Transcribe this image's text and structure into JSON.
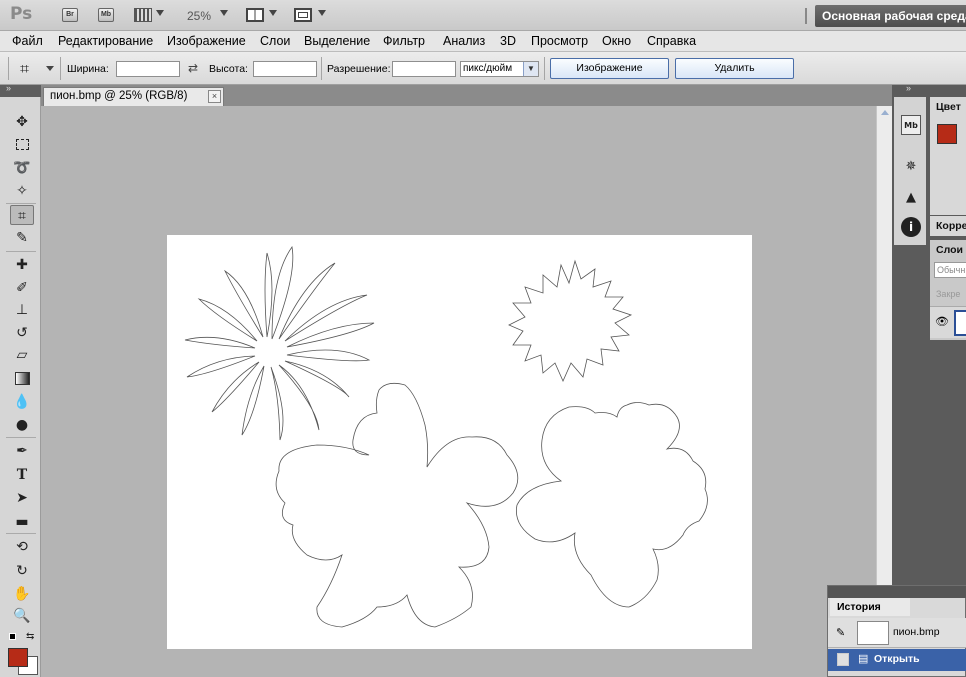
{
  "app": {
    "logo": "Ps",
    "appbar_buttons": [
      {
        "icon": "bridge-icon",
        "label": "Br"
      },
      {
        "icon": "minibridge-icon",
        "label": "Mb"
      }
    ],
    "zoom_display": "25%",
    "workspace": "Основная рабочая среда"
  },
  "menu": [
    "Файл",
    "Редактирование",
    "Изображение",
    "Слои",
    "Выделение",
    "Фильтр",
    "Анализ",
    "3D",
    "Просмотр",
    "Окно",
    "Справка"
  ],
  "options": {
    "width_label": "Ширина:",
    "height_label": "Высота:",
    "resolution_label": "Разрешение:",
    "units_value": "пикс/дюйм",
    "image_button": "Изображение",
    "delete_button": "Удалить"
  },
  "tools": [
    "move-tool",
    "marquee-tool",
    "lasso-tool",
    "quick-selection-tool",
    "crop-tool",
    "eyedropper-tool",
    "healing-brush-tool",
    "brush-tool",
    "clone-stamp-tool",
    "history-brush-tool",
    "eraser-tool",
    "gradient-tool",
    "blur-tool",
    "dodge-tool",
    "pen-tool",
    "type-tool",
    "path-selection-tool",
    "rectangle-tool",
    "3d-rotate-tool",
    "3d-orbit-tool",
    "hand-tool",
    "zoom-tool"
  ],
  "document": {
    "tab_title": "пион.bmp @ 25% (RGB/8)"
  },
  "colors": {
    "foreground": "#b62b17",
    "background": "#ffffff",
    "selection": "#3a62a8"
  },
  "panels": {
    "color_tab": "Цвет",
    "corrections_tab": "Корре",
    "layers_tab": "Слои",
    "blend_mode": "Обычн",
    "lock_label": "Закре"
  },
  "history": {
    "tab": "История",
    "snapshot_label": "пион.bmp",
    "state_label": "Открыть"
  }
}
